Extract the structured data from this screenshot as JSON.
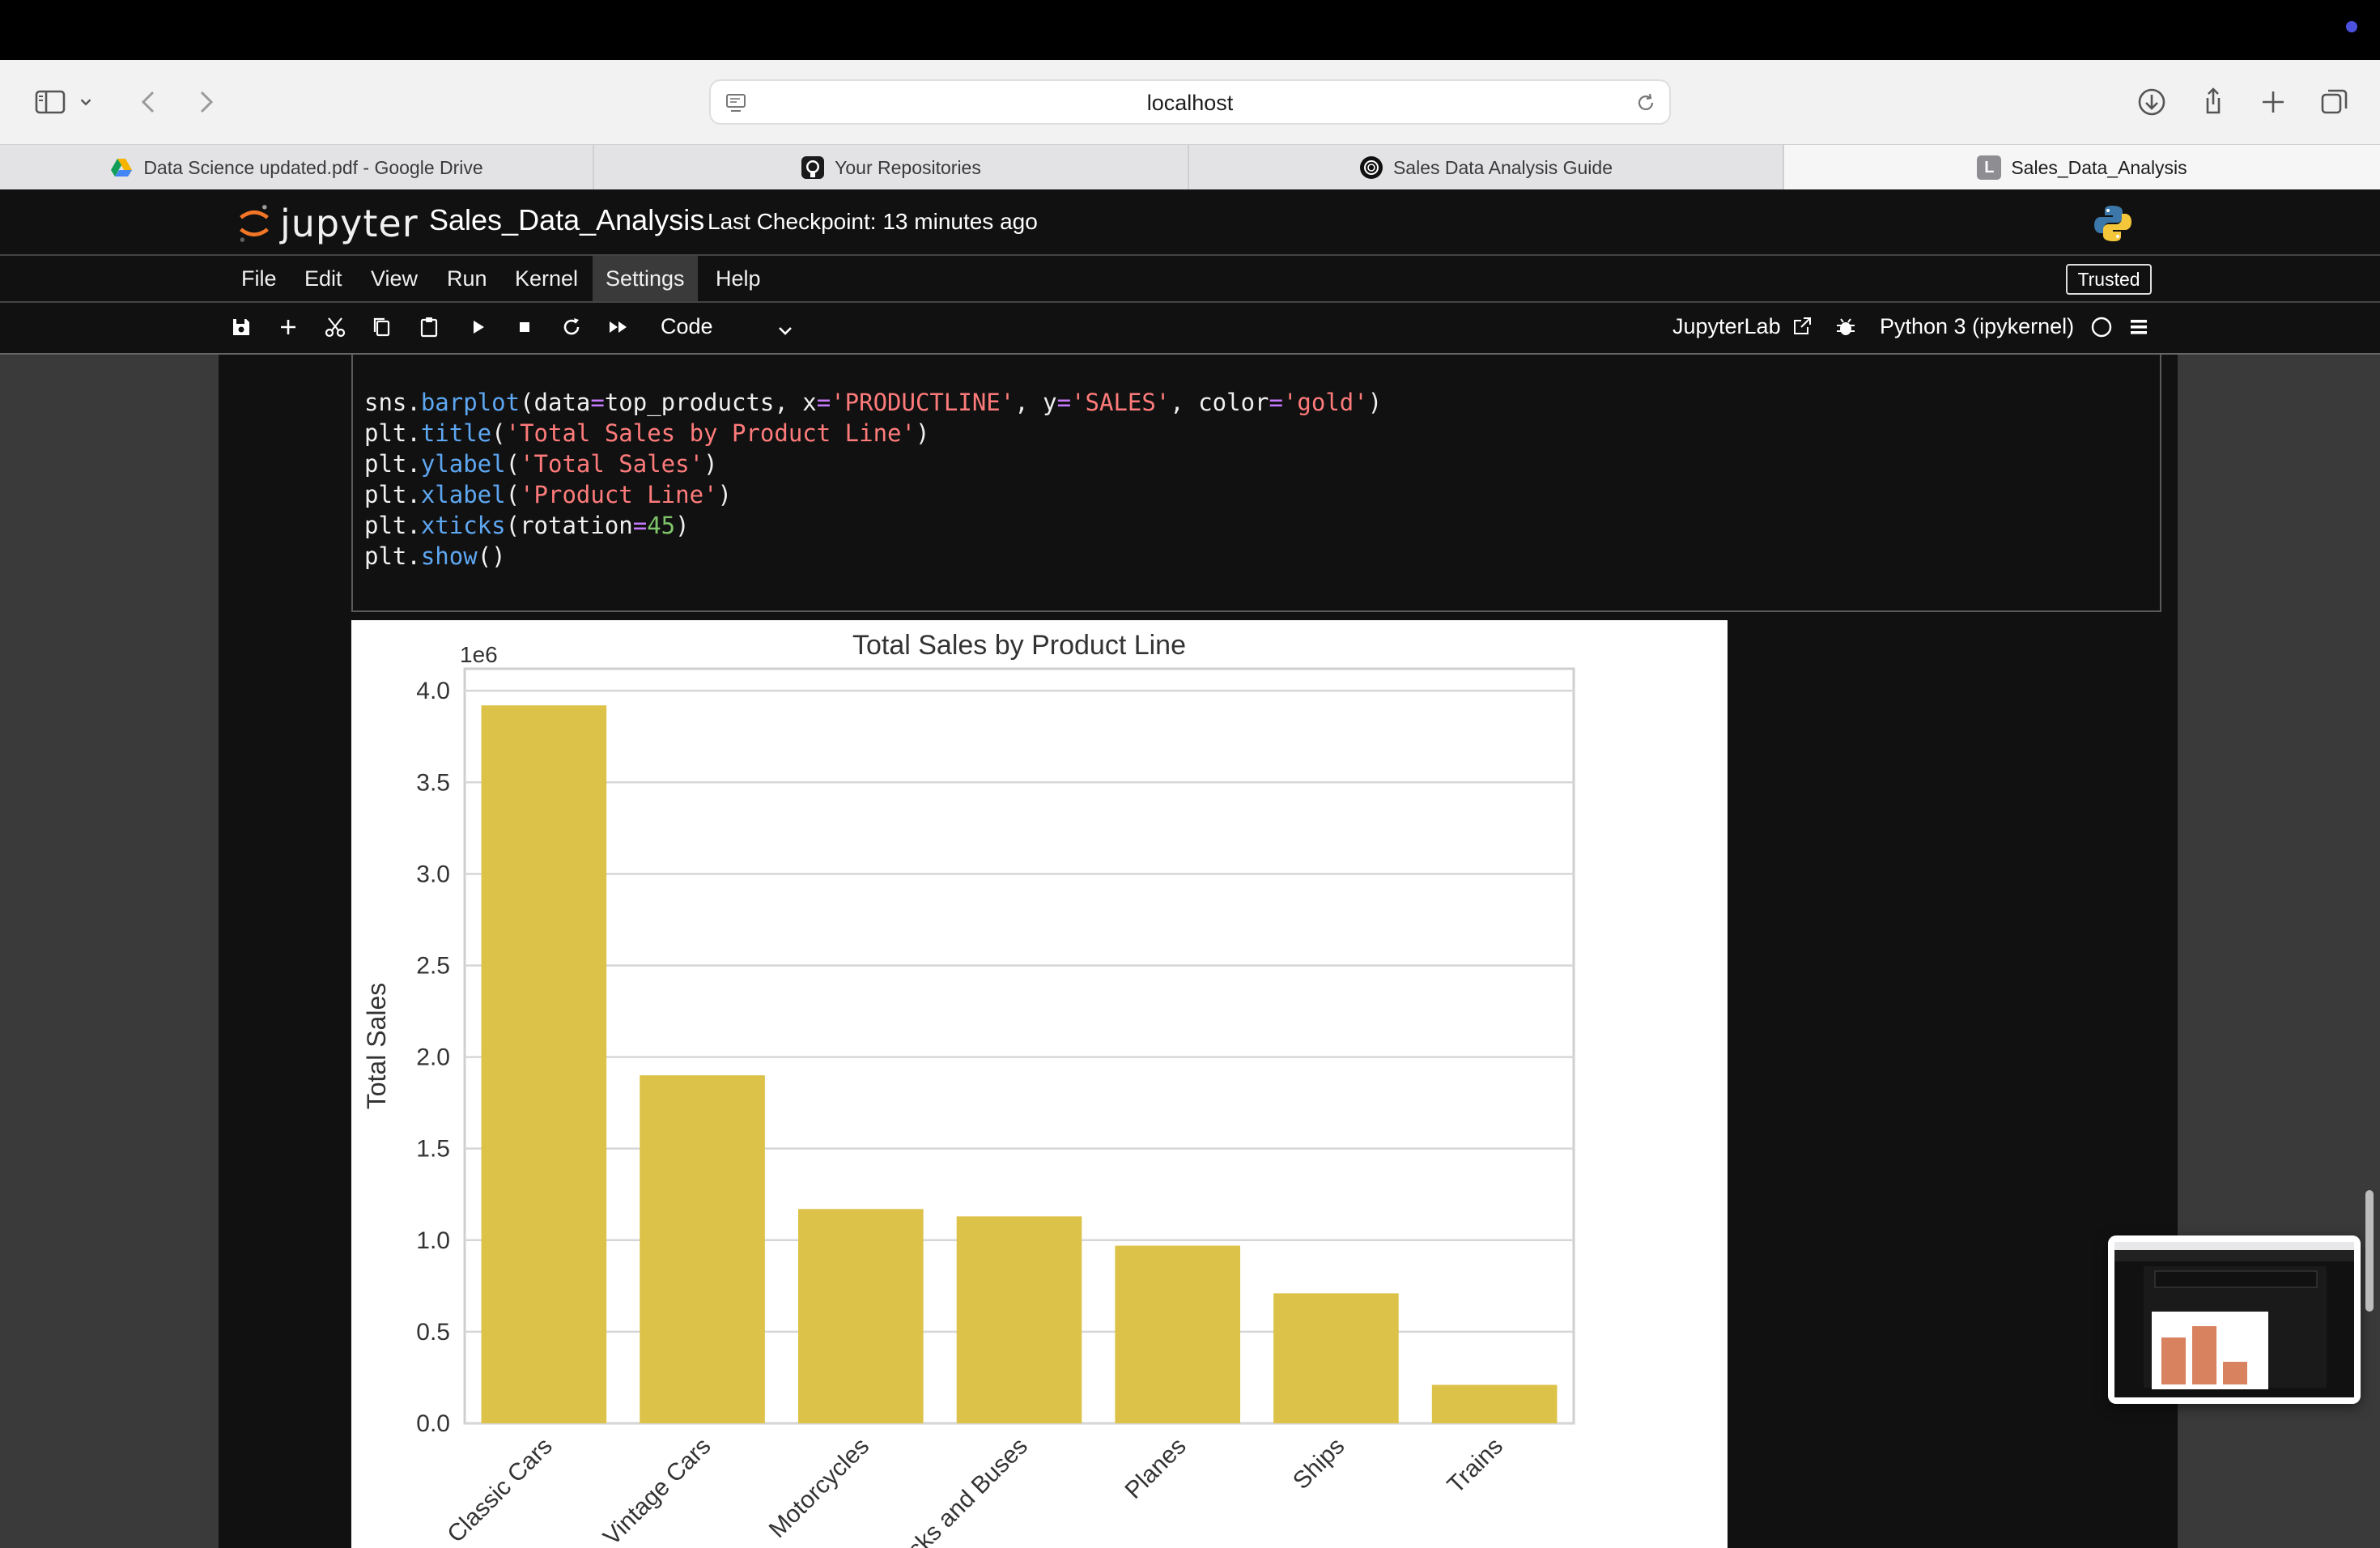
{
  "browser": {
    "url": "localhost",
    "tabs": [
      {
        "label": "Data Science updated.pdf - Google Drive",
        "favicon": "google-drive-icon"
      },
      {
        "label": "Your Repositories",
        "favicon": "github-icon"
      },
      {
        "label": "Sales Data Analysis Guide",
        "favicon": "openai-icon"
      },
      {
        "label": "Sales_Data_Analysis",
        "favicon": "jupyterlab-icon",
        "favicon_letter": "L"
      }
    ]
  },
  "jupyter": {
    "logo_text": "jupyter",
    "notebook_name": "Sales_Data_Analysis",
    "checkpoint": "Last Checkpoint: 13 minutes ago",
    "menu": [
      "File",
      "Edit",
      "View",
      "Run",
      "Kernel",
      "Settings",
      "Help"
    ],
    "active_menu": "Settings",
    "trusted": "Trusted",
    "cell_type": "Code",
    "jupyterlab_link": "JupyterLab",
    "kernel": "Python 3 (ipykernel)"
  },
  "code": {
    "line1": {
      "a": "sns.",
      "fn": "barplot",
      "b": "(data",
      "eq1": "=",
      "c": "top_products, x",
      "eq2": "=",
      "s1": "'PRODUCTLINE'",
      "d": ", y",
      "eq3": "=",
      "s2": "'SALES'",
      "e": ", color",
      "eq4": "=",
      "s3": "'gold'",
      "f": ")"
    },
    "line2": {
      "a": "plt.",
      "fn": "title",
      "b": "(",
      "s": "'Total Sales by Product Line'",
      "c": ")"
    },
    "line3": {
      "a": "plt.",
      "fn": "ylabel",
      "b": "(",
      "s": "'Total Sales'",
      "c": ")"
    },
    "line4": {
      "a": "plt.",
      "fn": "xlabel",
      "b": "(",
      "s": "'Product Line'",
      "c": ")"
    },
    "line5": {
      "a": "plt.",
      "fn": "xticks",
      "b": "(rotation",
      "eq": "=",
      "n": "45",
      "c": ")"
    },
    "line6": {
      "a": "plt.",
      "fn": "show",
      "b": "()"
    }
  },
  "chart_data": {
    "type": "bar",
    "title": "Total Sales by Product Line",
    "ylabel": "Total Sales",
    "y_offset_label": "1e6",
    "categories": [
      "Classic Cars",
      "Vintage Cars",
      "Motorcycles",
      "Trucks and Buses",
      "Planes",
      "Ships",
      "Trains"
    ],
    "values": [
      3.92,
      1.9,
      1.17,
      1.13,
      0.97,
      0.71,
      0.21
    ],
    "yticks": [
      "0.0",
      "0.5",
      "1.0",
      "1.5",
      "2.0",
      "2.5",
      "3.0",
      "3.5",
      "4.0"
    ],
    "ylim": [
      0,
      4.12
    ],
    "bar_color": "#dcc248",
    "grid": true
  },
  "colors": {
    "accent_tab_dot": "#4b52e0",
    "jupyter_orange": "#f37626"
  }
}
